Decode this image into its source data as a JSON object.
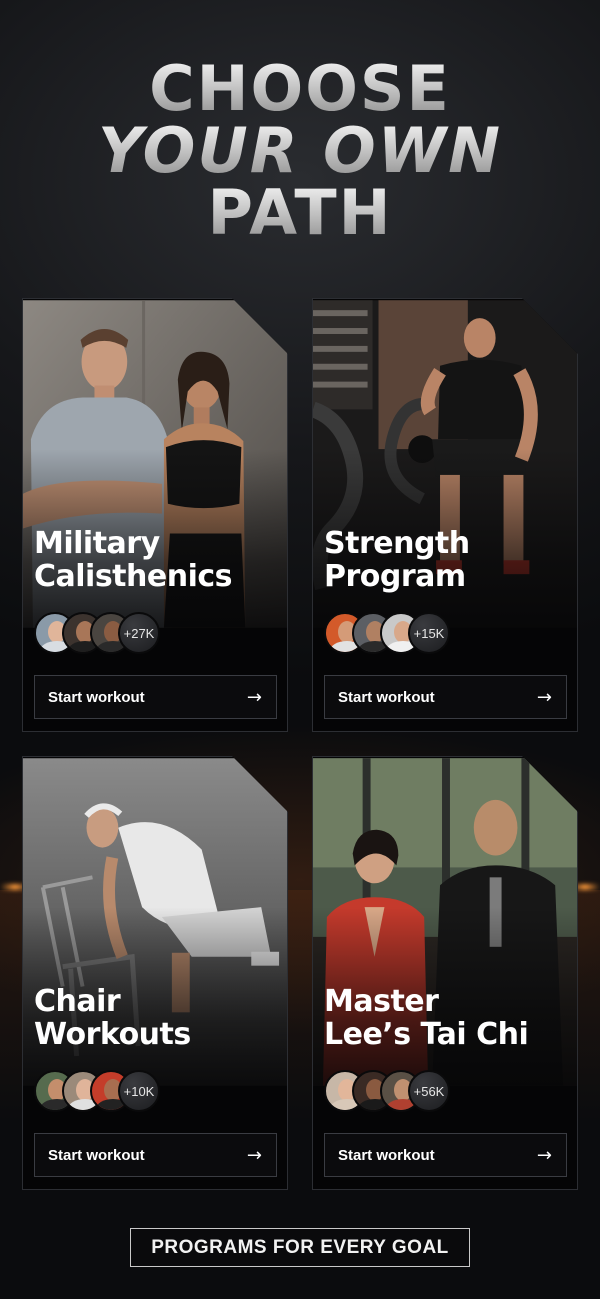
{
  "headline": {
    "line1": "CHOOSE",
    "line2": "YOUR OWN",
    "line3": "PATH"
  },
  "cards": [
    {
      "title_line1": "Military",
      "title_line2": "Calisthenics",
      "count": "+27K",
      "button_label": "Start workout",
      "button_icon": "arrow-right-icon",
      "photo": "couple-in-gym-icon"
    },
    {
      "title_line1": "Strength",
      "title_line2": "Program",
      "count": "+15K",
      "button_label": "Start workout",
      "button_icon": "arrow-right-icon",
      "photo": "battle-ropes-icon"
    },
    {
      "title_line1": "Chair",
      "title_line2": "Workouts",
      "count": "+10K",
      "button_label": "Start workout",
      "button_icon": "arrow-right-icon",
      "photo": "senior-lunge-chair-icon"
    },
    {
      "title_line1": "Master",
      "title_line2": "Lee’s Tai Chi",
      "count": "+56K",
      "button_label": "Start workout",
      "button_icon": "arrow-right-icon",
      "photo": "tai-chi-pair-icon"
    }
  ],
  "footer": {
    "label": "PROGRAMS FOR EVERY GOAL"
  },
  "colors": {
    "background": "#0b0c0e",
    "card_background": "#050506",
    "button_border": "#3a3c42",
    "accent_glow": "#ff9a3a"
  }
}
